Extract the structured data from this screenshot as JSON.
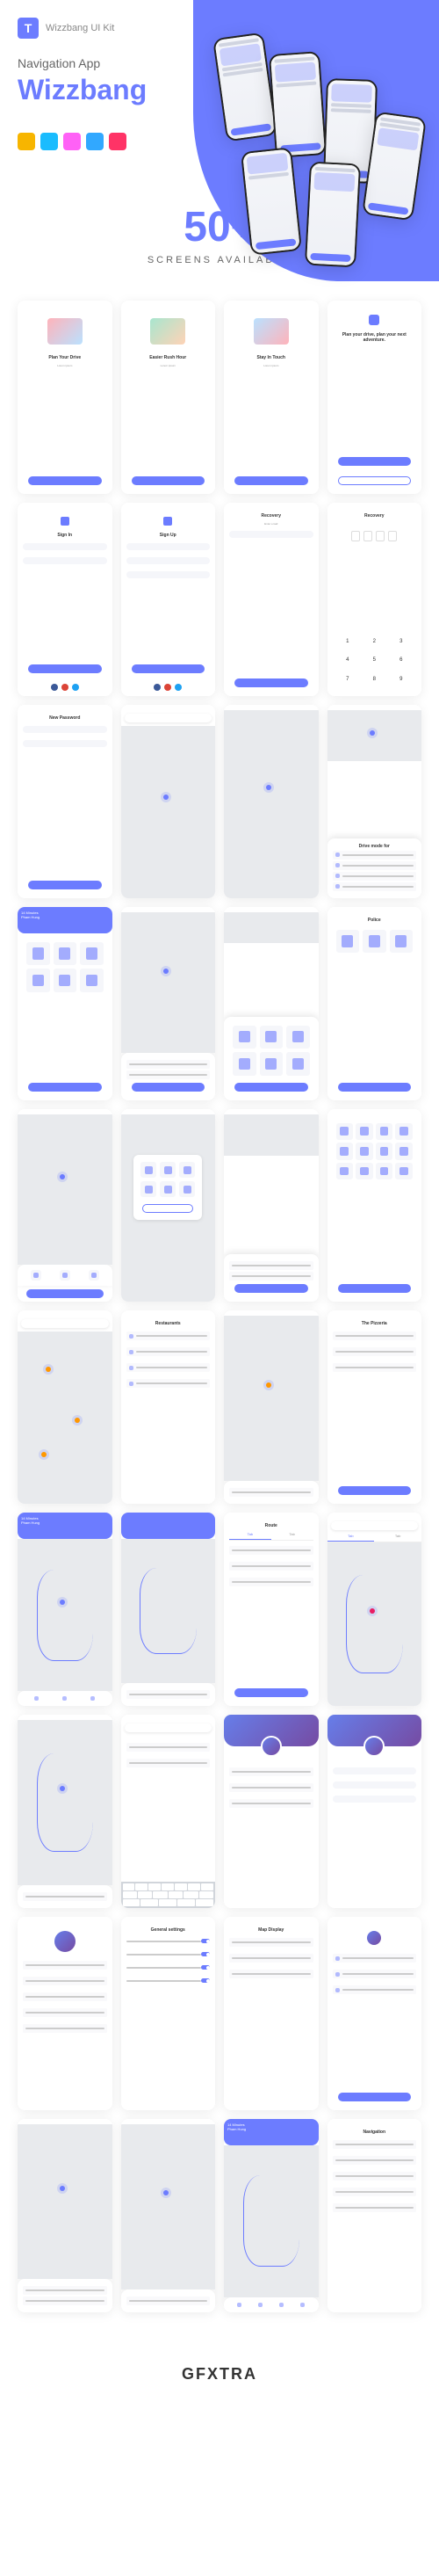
{
  "header": {
    "kit_name": "Wizzbang\nUI Kit",
    "subtitle": "Navigation App",
    "title": "Wizzbang"
  },
  "stats": {
    "number": "50+",
    "label": "SCREENS AVAILABLE"
  },
  "onboarding": {
    "s1_title": "Plan Your Drive",
    "s2_title": "Easier Rush Hour",
    "s3_title": "Stay In Touch",
    "s4_title": "Plan your drive, plan your next adventure."
  },
  "auth": {
    "signin": "Sign In",
    "signup": "Sign Up",
    "recovery": "Recovery",
    "new_password": "New Password"
  },
  "nav": {
    "location": "14 Minutes",
    "street": "Pham Hung",
    "restaurants": "Restaurants",
    "police": "Police",
    "the_pizzeria": "The Pizzeria",
    "route": "Route",
    "navigation": "Navigation",
    "general_settings": "General settings",
    "map_display": "Map Display",
    "drive_mode": "Drive mode for"
  },
  "footer": {
    "logo": "GFXTRA"
  }
}
